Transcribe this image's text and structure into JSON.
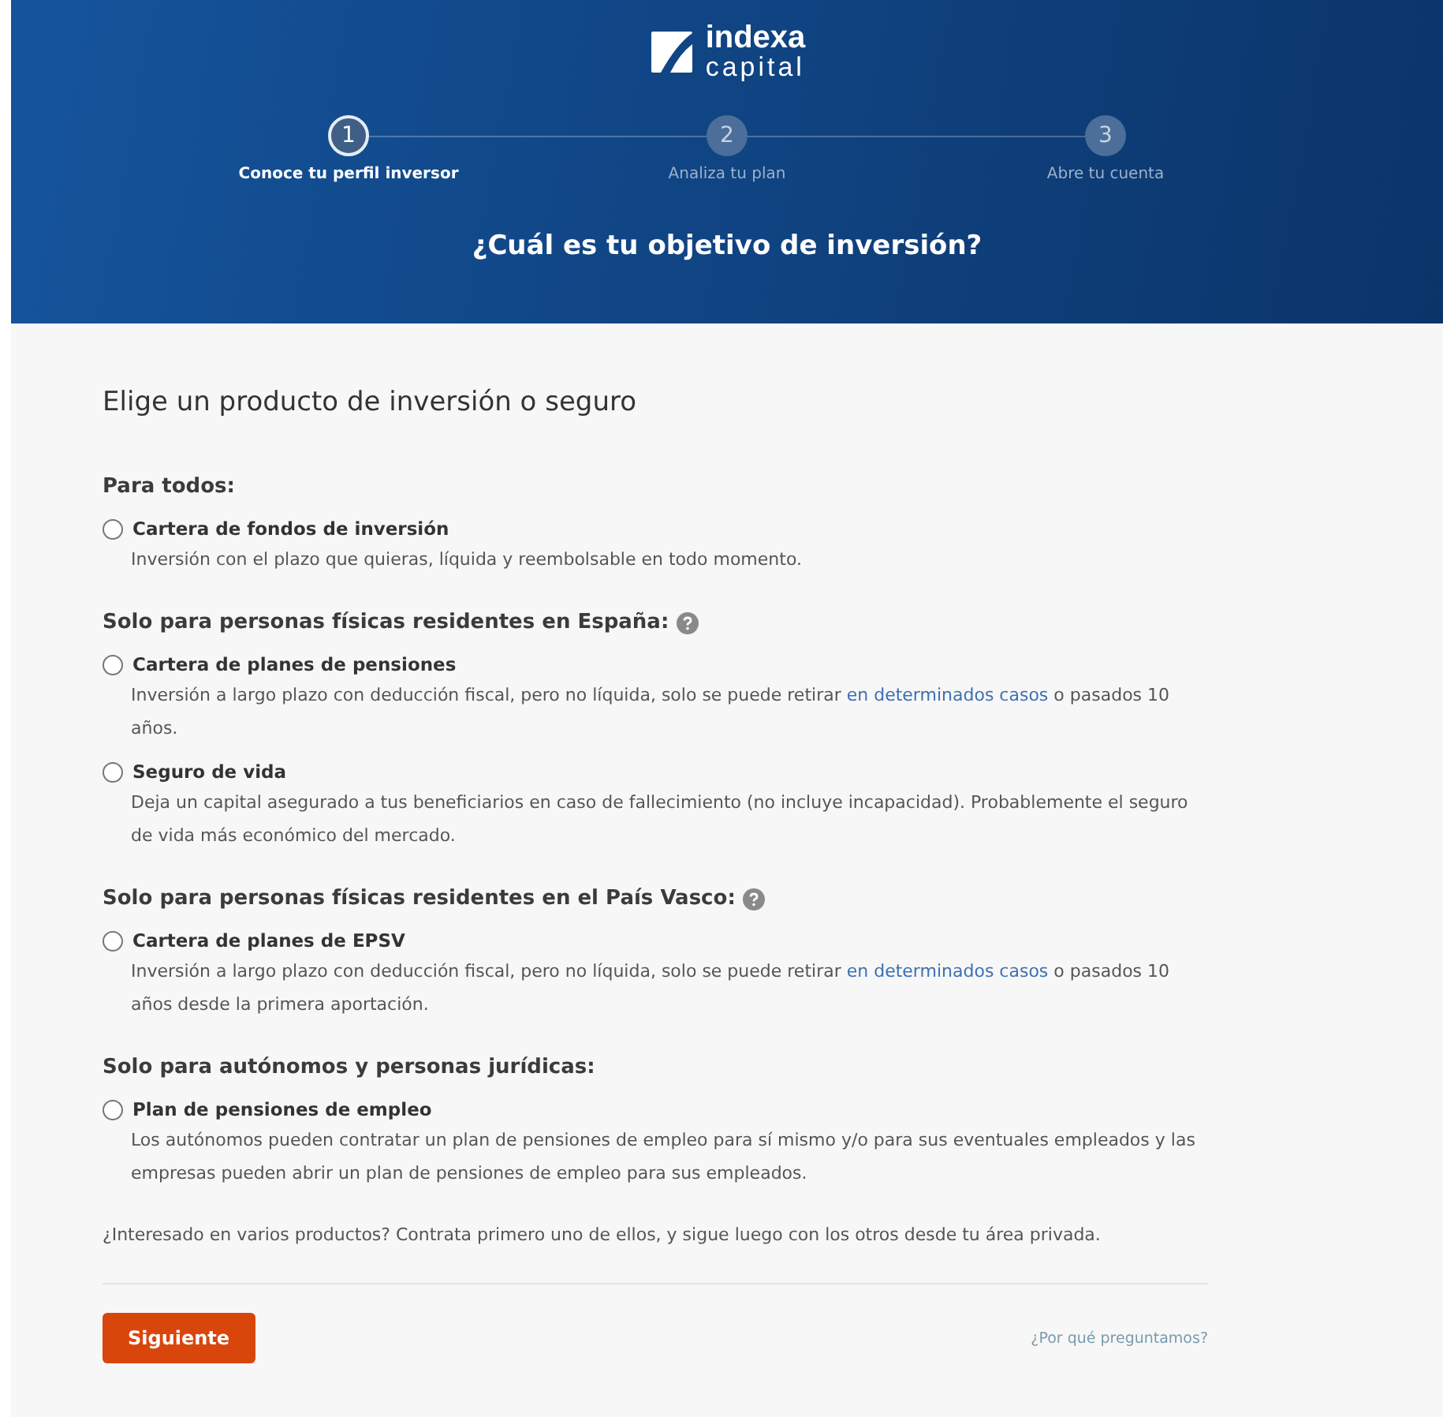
{
  "header": {
    "logo": {
      "line_1": "indexa",
      "line_2": "capital"
    },
    "steps": [
      {
        "number": "1",
        "label": "Conoce tu perfil inversor",
        "selected": true
      },
      {
        "number": "2",
        "label": "Analiza tu plan",
        "selected": false
      },
      {
        "number": "3",
        "label": "Abre tu cuenta",
        "selected": false
      }
    ],
    "question": "¿Cuál es tu objetivo de inversión?"
  },
  "form": {
    "title": "Elige un producto de inversión o seguro",
    "groups": [
      {
        "heading": "Para todos:",
        "help": false,
        "options": [
          {
            "label": "Cartera de fondos de inversión",
            "selected": false,
            "description": [
              {
                "kind": "text",
                "text": "Inversión con el plazo que quieras, líquida y reembolsable en todo momento."
              }
            ]
          }
        ]
      },
      {
        "heading": "Solo para personas físicas residentes en España:",
        "help": true,
        "options": [
          {
            "label": "Cartera de planes de pensiones",
            "selected": false,
            "description": [
              {
                "kind": "text",
                "text": "Inversión a largo plazo con deducción fiscal, pero no líquida, solo se puede retirar "
              },
              {
                "kind": "link",
                "text": "en determinados casos"
              },
              {
                "kind": "text",
                "text": " o pasados 10 años."
              }
            ]
          },
          {
            "label": "Seguro de vida",
            "selected": false,
            "description": [
              {
                "kind": "text",
                "text": "Deja un capital asegurado a tus beneficiarios en caso de fallecimiento (no incluye incapacidad). Probablemente el seguro de vida más económico del mercado."
              }
            ]
          }
        ]
      },
      {
        "heading": "Solo para personas físicas residentes en el País Vasco:",
        "help": true,
        "options": [
          {
            "label": "Cartera de planes de EPSV",
            "selected": false,
            "description": [
              {
                "kind": "text",
                "text": "Inversión a largo plazo con deducción fiscal, pero no líquida, solo se puede retirar "
              },
              {
                "kind": "link",
                "text": "en determinados casos"
              },
              {
                "kind": "text",
                "text": " o pasados 10 años desde la primera aportación."
              }
            ]
          }
        ]
      },
      {
        "heading": "Solo para autónomos y personas jurídicas:",
        "help": false,
        "options": [
          {
            "label": "Plan de pensiones de empleo",
            "selected": false,
            "description": [
              {
                "kind": "text",
                "text": "Los autónomos pueden contratar un plan de pensiones de empleo para sí mismo y/o para sus eventuales empleados y las empresas pueden abrir un plan de pensiones de empleo para sus empleados."
              }
            ]
          }
        ]
      }
    ],
    "note": "¿Interesado en varios productos? Contrata primero uno de ellos, y sigue luego con los otros desde tu área privada.",
    "next_button": "Siguiente",
    "why_link": "¿Por qué preguntamos?"
  }
}
